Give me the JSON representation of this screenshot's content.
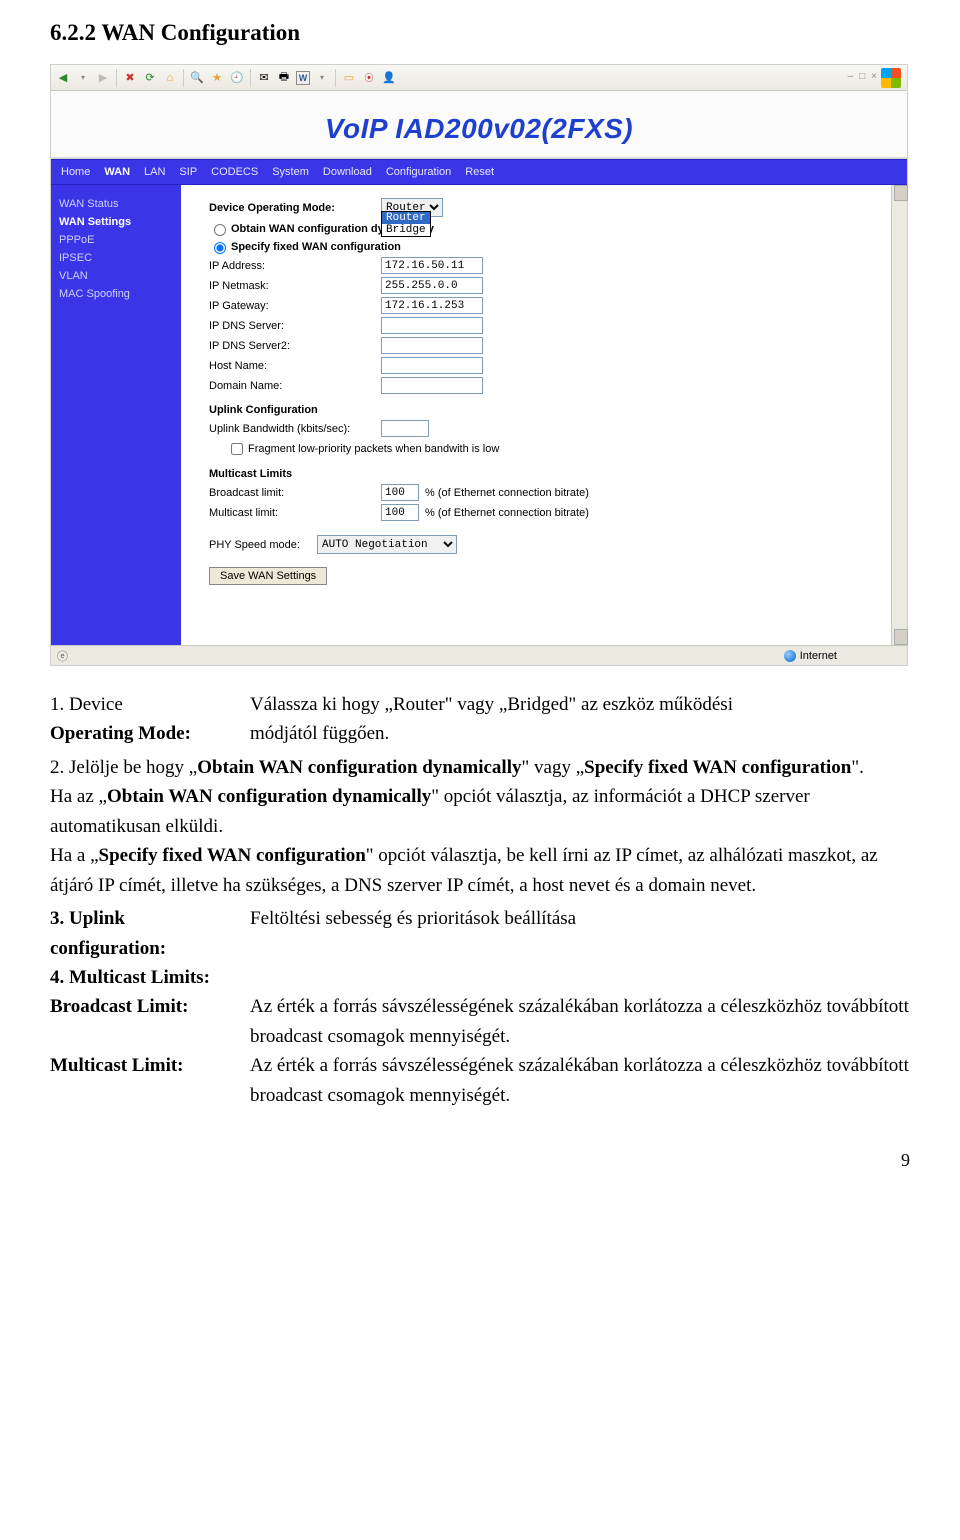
{
  "section_title": "6.2.2 WAN Configuration",
  "screenshot": {
    "toolbar_icons": [
      "back",
      "fwd",
      "stop",
      "refresh",
      "home",
      "search",
      "fav",
      "history",
      "mail",
      "print",
      "word",
      "link",
      "folder",
      "cc",
      "msn"
    ],
    "product_name": "VoIP IAD200v02(2FXS)",
    "tabs": [
      "Home",
      "WAN",
      "LAN",
      "SIP",
      "CODECS",
      "System",
      "Download",
      "Configuration",
      "Reset"
    ],
    "active_tab": "WAN",
    "sidebar": [
      "WAN Status",
      "WAN Settings",
      "PPPoE",
      "IPSEC",
      "VLAN",
      "MAC Spoofing"
    ],
    "sidebar_active": "WAN Settings",
    "form": {
      "mode_label": "Device Operating Mode:",
      "mode_value": "Router",
      "mode_options": [
        "Router",
        "Bridge"
      ],
      "radio_dyn": "Obtain WAN configuration dynamically",
      "radio_fixed": "Specify fixed WAN configuration",
      "ip_label": "IP Address:",
      "ip_value": "172.16.50.11",
      "nm_label": "IP Netmask:",
      "nm_value": "255.255.0.0",
      "gw_label": "IP Gateway:",
      "gw_value": "172.16.1.253",
      "dns1_label": "IP DNS Server:",
      "dns1_value": "",
      "dns2_label": "IP DNS Server2:",
      "dns2_value": "",
      "host_label": "Host Name:",
      "host_value": "",
      "dom_label": "Domain Name:",
      "dom_value": "",
      "uplink_hdr": "Uplink Configuration",
      "bw_label": "Uplink Bandwidth (kbits/sec):",
      "bw_value": "",
      "frag_label": "Fragment low-priority packets when bandwith is low",
      "mc_hdr": "Multicast Limits",
      "bc_label": "Broadcast limit:",
      "bc_value": "100",
      "mc_label": "Multicast limit:",
      "mc_value": "100",
      "pct_suffix": "% (of Ethernet connection bitrate)",
      "phy_label": "PHY Speed mode:",
      "phy_value": "AUTO Negotiation",
      "save_btn": "Save WAN Settings"
    },
    "status_zone": "Internet"
  },
  "text": {
    "r1_c1": "1. Device",
    "r1_c2": "Válassza ki hogy „Router\" vagy „Bridged\" az eszköz működési",
    "r2_c1": "Operating Mode:",
    "r2_c2": "módjától függően.",
    "p2a": "2. Jelölje be hogy „Obtain WAN configuration dynamically\" vagy „Specify fixed WAN configuration\".",
    "p2b": "Ha az „Obtain WAN configuration dynamically\" opciót választja, az információt a DHCP szerver automatikusan elküldi.",
    "p2c": "Ha a „Specify fixed WAN configuration\" opciót választja, be kell írni az IP címet, az alhálózati maszkot, az átjáró IP címét, illetve ha szükséges, a DNS szerver IP címét, a host nevet és a domain nevet.",
    "r3_c1": "3. Uplink",
    "r3_c2": "Feltöltési sebesség és prioritások beállítása",
    "r4_c1": "configuration:",
    "r5_c1": "4. Multicast Limits:",
    "r6_c1": "Broadcast Limit:",
    "r6_c2": "Az érték a forrás sávszélességének százalékában korlátozza a céleszközhöz továbbított broadcast csomagok mennyiségét.",
    "r7_c1": "Multicast Limit:",
    "r7_c2": "Az érték a forrás sávszélességének százalékában korlátozza a céleszközhöz továbbított broadcast csomagok mennyiségét."
  },
  "page_number": "9"
}
